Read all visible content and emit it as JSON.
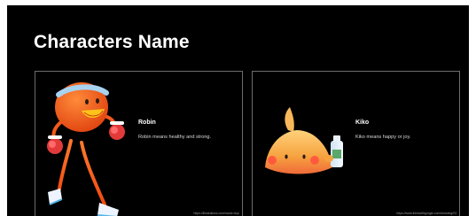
{
  "slide": {
    "title": "Characters Name",
    "background_color": "#000000",
    "text_color": "#ffffff"
  },
  "cards": [
    {
      "name": "Robin",
      "description": "Robin means healthy and strong.",
      "source_url": "https://illustrations.com/name-boy/",
      "illustration_icon": "robin-character-icon",
      "accent_colors": [
        "#f25a1b",
        "#ffc21a",
        "#e23a3a"
      ]
    },
    {
      "name": "Kiko",
      "description": "Kiko means happy or joy.",
      "source_url": "https://www.thinkwithgoogle.com/meaning/03",
      "illustration_icon": "kiko-character-icon",
      "accent_colors": [
        "#f6b24b",
        "#ff6a4d",
        "#ffd07a"
      ]
    }
  ]
}
